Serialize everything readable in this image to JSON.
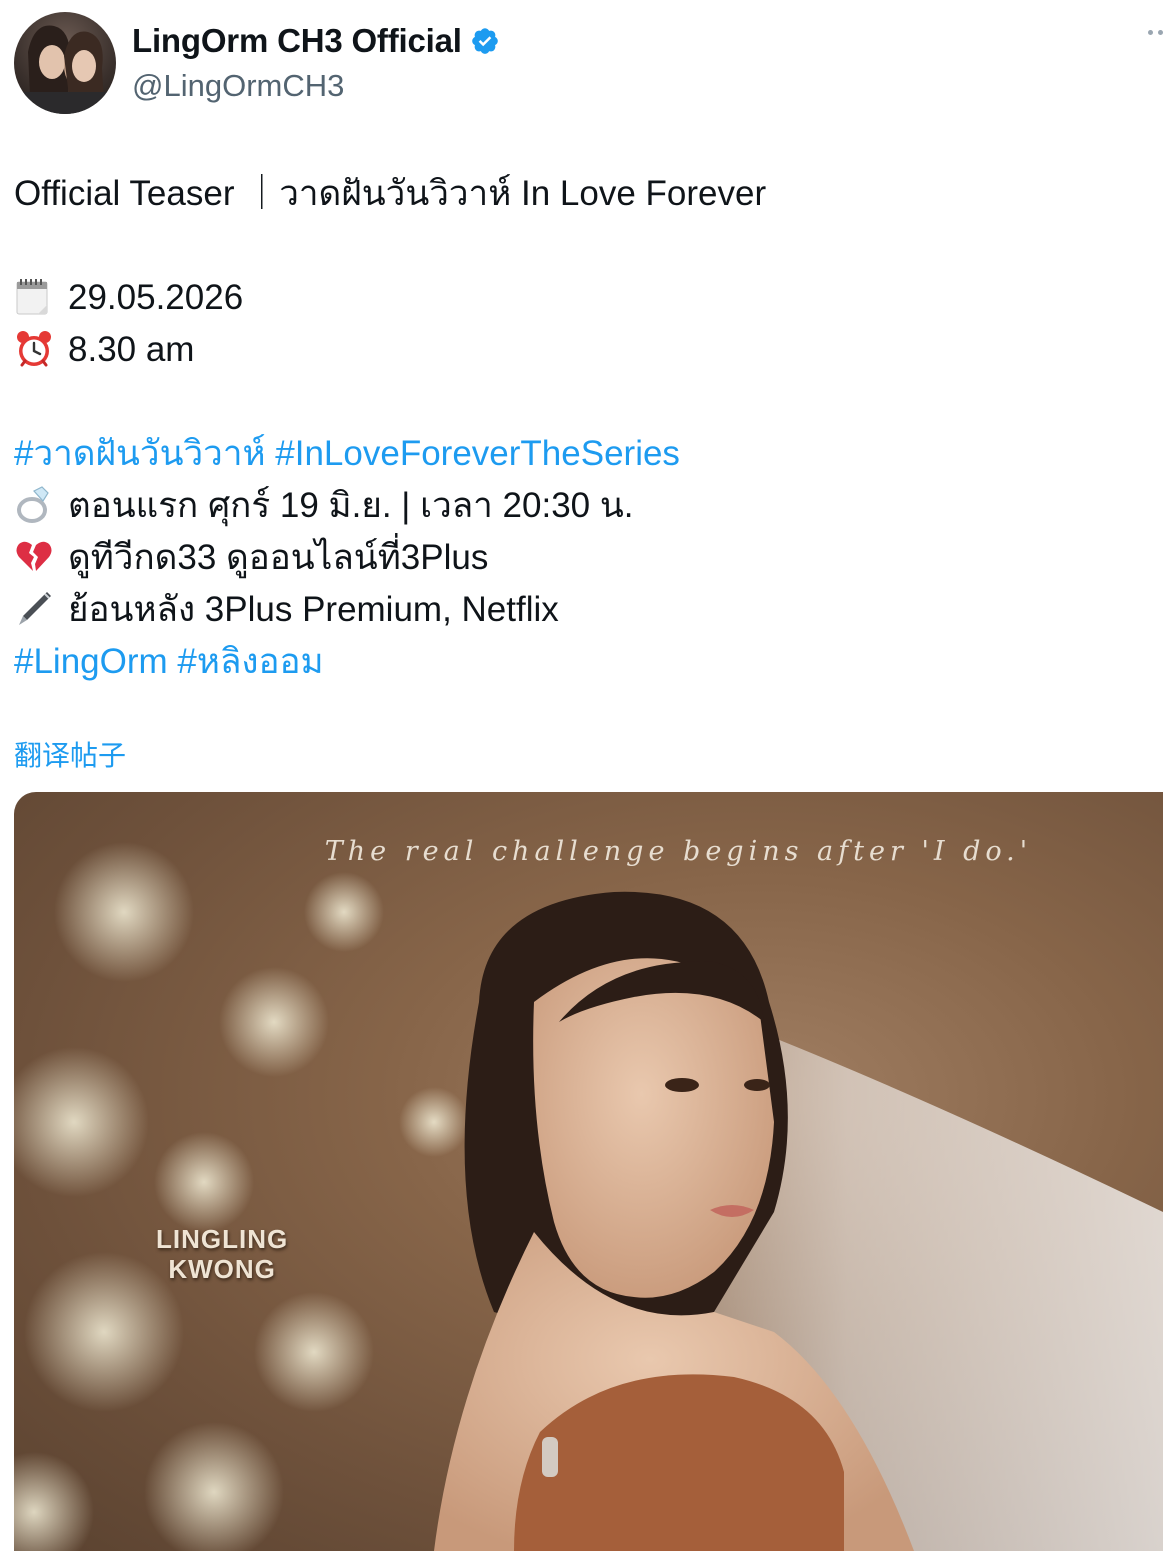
{
  "author": {
    "display_name": "LingOrm CH3 Official",
    "handle": "@LingOrmCH3",
    "verified": true,
    "verified_icon": "verified-badge-icon",
    "accent_color": "#1d9bf0"
  },
  "tweet": {
    "title_line": "Official Teaser ｜วาดฝันวันวิวาห์ In Love Forever",
    "date_line": {
      "icon": "calendar-icon",
      "text": "29.05.2026"
    },
    "time_line": {
      "icon": "alarm-clock-icon",
      "text": "8.30 am"
    },
    "hashtags_1": [
      "#วาดฝันวันวิวาห์",
      "#InLoveForeverTheSeries"
    ],
    "info_lines": [
      {
        "icon": "ring-icon",
        "text": "ตอนแรก ศุกร์ 19 มิ.ย. | เวลา 20:30 น."
      },
      {
        "icon": "broken-heart-icon",
        "text": "ดูทีวีกด33 ดูออนไลน์ที่3Plus"
      },
      {
        "icon": "pen-icon",
        "text": "ย้อนหลัง 3Plus Premium, Netflix"
      }
    ],
    "hashtags_2": [
      "#LingOrm",
      "#หลิงออม"
    ]
  },
  "translate_label": "翻译帖子",
  "media": {
    "tagline": "The real challenge begins after 'I do.'",
    "actor_name_line1": "LINGLING",
    "actor_name_line2": "KWONG"
  }
}
